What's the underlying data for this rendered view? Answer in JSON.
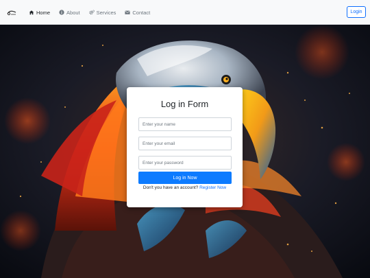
{
  "navbar": {
    "brand_icon": "logo-icon",
    "items": [
      {
        "label": "Home",
        "icon": "home-icon",
        "active": true
      },
      {
        "label": "About",
        "icon": "info-icon",
        "active": false
      },
      {
        "label": "Services",
        "icon": "cogs-icon",
        "active": false
      },
      {
        "label": "Contact",
        "icon": "envelope-icon",
        "active": false
      }
    ],
    "login_label": "Login"
  },
  "login_form": {
    "title": "Log in Form",
    "name_placeholder": "Enter your name",
    "email_placeholder": "Enter your email",
    "password_placeholder": "Enter your password",
    "submit_label": "Log in Now",
    "register_prompt": "Don't you have an account?",
    "register_link": "Register Now"
  },
  "colors": {
    "accent": "#0d6efd",
    "submit_button": "#0d7bff",
    "navbar_bg": "#f8f9fa"
  },
  "background_image": "eagle-feathers-artwork"
}
